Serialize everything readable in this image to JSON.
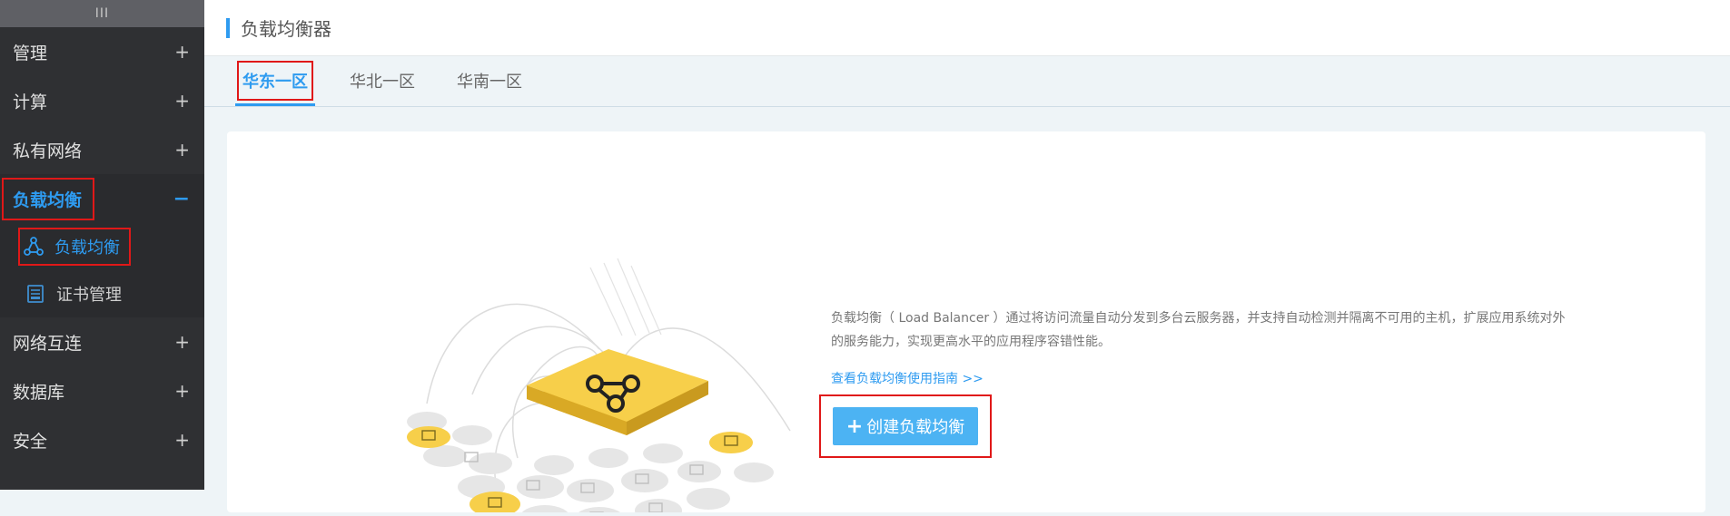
{
  "sidebar": {
    "grip": "III",
    "items": [
      {
        "label": "管理"
      },
      {
        "label": "计算"
      },
      {
        "label": "私有网络"
      },
      {
        "label": "负载均衡"
      },
      {
        "label": "网络互连"
      },
      {
        "label": "数据库"
      },
      {
        "label": "安全"
      }
    ],
    "sub_items": [
      {
        "label": "负载均衡"
      },
      {
        "label": "证书管理"
      }
    ],
    "plus": "+",
    "minus": "−"
  },
  "header": {
    "title": "负载均衡器"
  },
  "tabs": [
    {
      "label": "华东一区"
    },
    {
      "label": "华北一区"
    },
    {
      "label": "华南一区"
    }
  ],
  "content": {
    "description": "负载均衡（ Load Balancer ）通过将访问流量自动分发到多台云服务器，并支持自动检测并隔离不可用的主机，扩展应用系统对外的服务能力，实现更高水平的应用程序容错性能。",
    "guide_link": "查看负载均衡使用指南 >>",
    "create_button": "创建负载均衡",
    "create_plus": "+"
  },
  "colors": {
    "accent": "#2e9bf0",
    "sidebar_bg": "#2f3033",
    "highlight": "#e01818",
    "button_bg": "#4cb3f3",
    "illustration_yellow": "#f7cf4a"
  }
}
